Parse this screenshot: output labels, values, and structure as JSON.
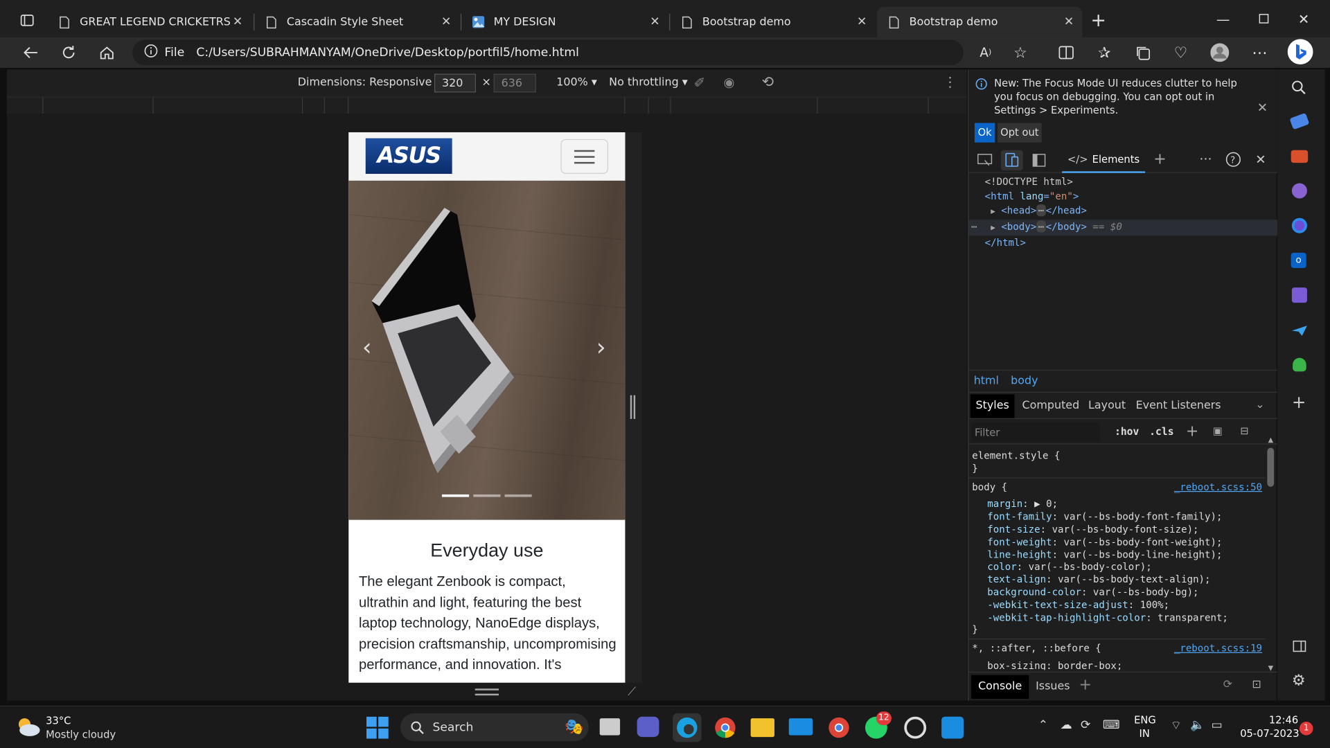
{
  "tabs": [
    {
      "title": "GREAT LEGEND CRICKETRS",
      "icon": "page-icon"
    },
    {
      "title": "Cascadin Style Sheet",
      "icon": "page-icon"
    },
    {
      "title": "MY DESIGN",
      "icon": "image-icon"
    },
    {
      "title": "Bootstrap demo",
      "icon": "page-icon"
    },
    {
      "title": "Bootstrap demo",
      "icon": "page-icon"
    }
  ],
  "address": {
    "scheme": "File",
    "url": "C:/Users/SUBRAHMANYAM/OneDrive/Desktop/portfil5/home.html"
  },
  "device_toolbar": {
    "dimensions": "Dimensions: Responsive",
    "width": "320",
    "x": "×",
    "height": "636",
    "zoom": "100%",
    "throttle": "No throttling"
  },
  "page": {
    "logo": "ASUS",
    "heading": "Everyday use",
    "text": "The elegant Zenbook is compact, ultrathin and light, featuring the best laptop technology, NanoEdge displays, precision craftsmanship, uncompromising performance, and innovation. It's"
  },
  "devtools": {
    "notice": "New: The Focus Mode UI reduces clutter to help you focus on debugging. You can opt out in Settings > Experiments.",
    "ok": "Ok",
    "opt_out": "Opt out",
    "elements_tab": "Elements",
    "dom": [
      "<!DOCTYPE html>",
      "<html lang=\"en\">",
      "<head>",
      "</head>",
      "<body>",
      "</body>",
      "== $0",
      "</html>"
    ],
    "crumbs": [
      "html",
      "body"
    ],
    "styles_tabs": [
      "Styles",
      "Computed",
      "Layout",
      "Event Listeners"
    ],
    "filter_placeholder": "Filter",
    "hov": ":hov",
    "cls": ".cls",
    "element_style": "element.style {",
    "close_brace": "}",
    "body_rule": "body {",
    "body_src": "_reboot.scss:50",
    "props": [
      [
        "margin",
        "▶ 0;"
      ],
      [
        "font-family",
        "var(--bs-body-font-family);"
      ],
      [
        "font-size",
        "var(--bs-body-font-size);"
      ],
      [
        "font-weight",
        "var(--bs-body-font-weight);"
      ],
      [
        "line-height",
        "var(--bs-body-line-height);"
      ],
      [
        "color",
        "var(--bs-body-color);"
      ],
      [
        "text-align",
        "var(--bs-body-text-align);"
      ],
      [
        "background-color",
        "var(--bs-body-bg);"
      ],
      [
        "-webkit-text-size-adjust",
        "100%;"
      ],
      [
        "-webkit-tap-highlight-color",
        "transparent;"
      ]
    ],
    "next_rule": "*, ::after, ::before {",
    "next_src": "_reboot.scss:19",
    "next_prop": "box-sizing: border-box;",
    "drawer_tabs": [
      "Console",
      "Issues"
    ]
  },
  "taskbar": {
    "temp": "33°C",
    "weather": "Mostly cloudy",
    "search": "Search",
    "lang1": "ENG",
    "lang2": "IN",
    "time": "12:46",
    "date": "05-07-2023",
    "whatsapp_badge": "12",
    "notif_badge": "1"
  },
  "colors": {
    "accent": "#0078d4",
    "link": "#4fa7f5",
    "tag": "#7eb6f6",
    "attr": "#9cdcfe",
    "string": "#ce9178"
  }
}
